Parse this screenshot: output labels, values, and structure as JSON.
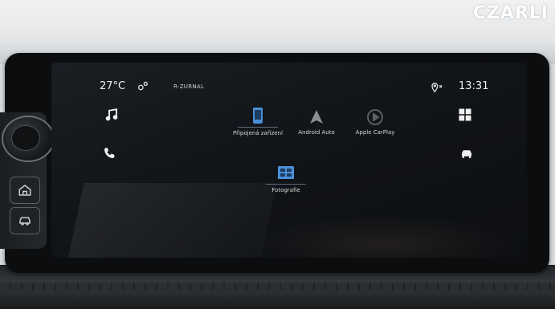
{
  "environment": {
    "background_sign": "CZARLI"
  },
  "status_bar": {
    "temperature": "27°C",
    "source": "R-ZURNAL",
    "time": "13:31"
  },
  "left_rail": [
    {
      "name": "music-icon"
    },
    {
      "name": "phone-icon"
    }
  ],
  "right_rail": [
    {
      "name": "apps-grid-icon"
    },
    {
      "name": "car-icon"
    }
  ],
  "tiles": [
    {
      "label": "Připojená zařízení",
      "icon": "connected-devices-icon",
      "color": "#4a90d9"
    },
    {
      "label": "Android Auto",
      "icon": "android-auto-icon",
      "color": "#8a8f94"
    },
    {
      "label": "Apple CarPlay",
      "icon": "apple-carplay-icon",
      "color": "#5a5f64"
    },
    {
      "label": "Fotografie",
      "icon": "photos-icon",
      "color": "#4a90d9"
    }
  ],
  "colors": {
    "accent": "#4a90d9",
    "screen_bg": "#111418",
    "text": "#f2f2f2"
  }
}
